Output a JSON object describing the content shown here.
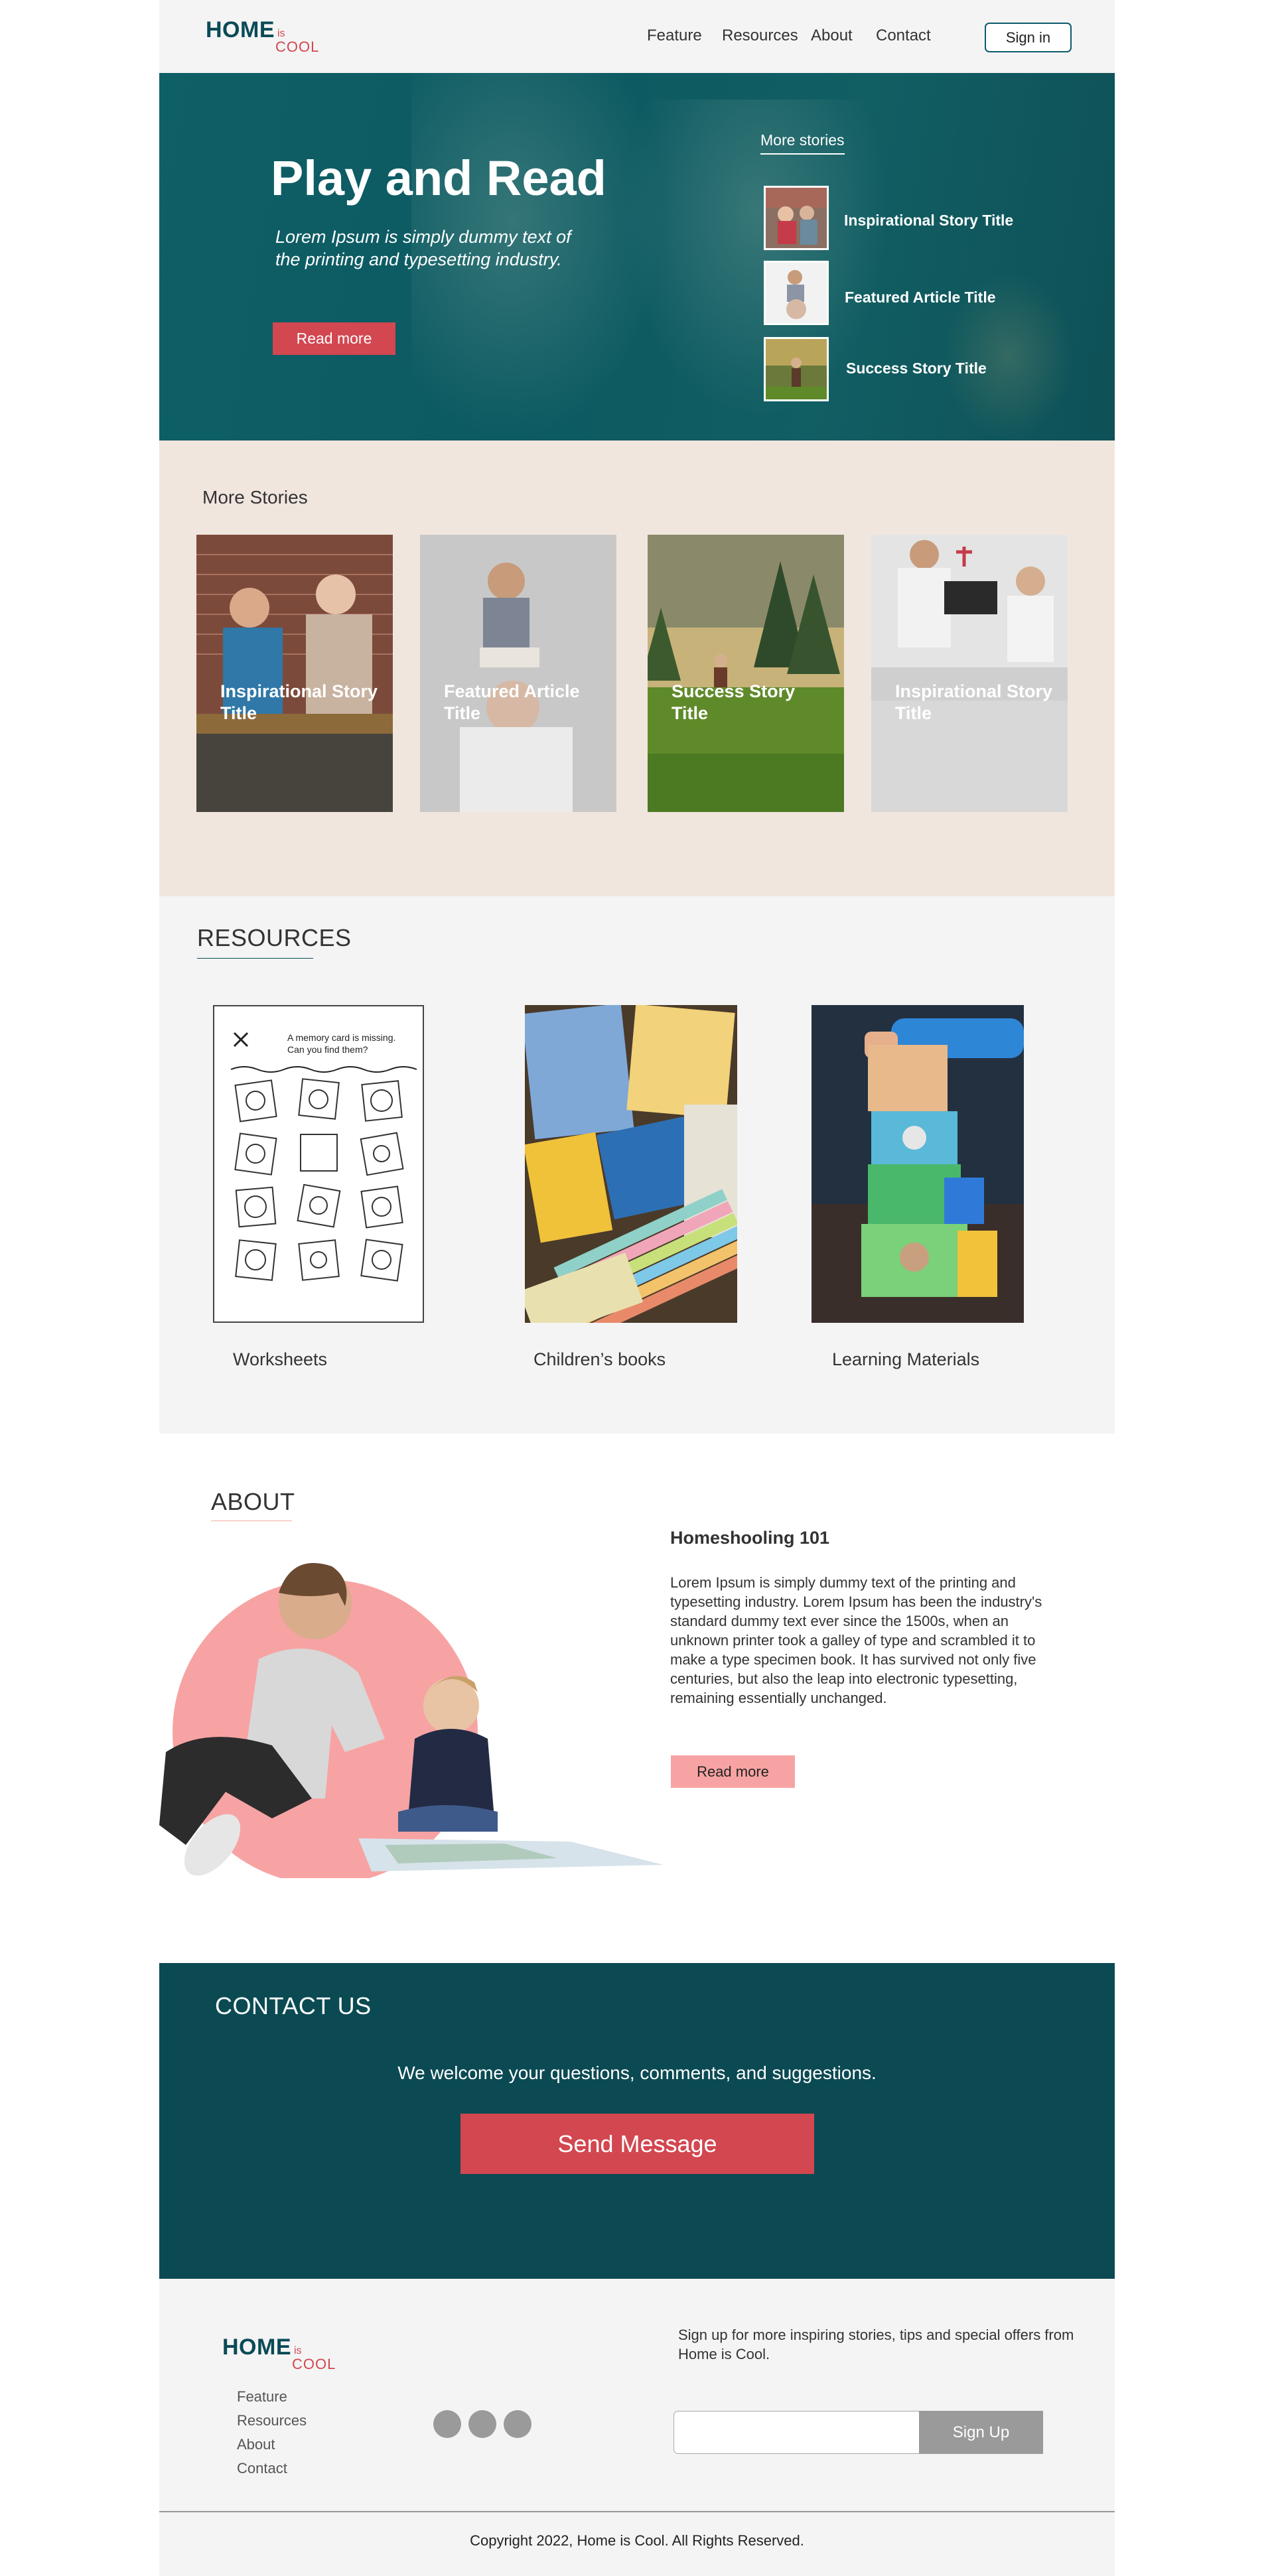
{
  "header": {
    "logo": {
      "home": "HOME",
      "is": "is",
      "cool": "COOL"
    },
    "nav": [
      "Feature",
      "Resources",
      "About",
      "Contact"
    ],
    "signin": "Sign in"
  },
  "hero": {
    "title": "Play and Read",
    "subtitle": "Lorem Ipsum is simply dummy text of the printing and typesetting industry.",
    "button": "Read more",
    "more_stories_label": "More stories",
    "stories": [
      "Inspirational Story Title",
      "Featured Article Title",
      "Success Story Title"
    ]
  },
  "more_stories": {
    "title": "More Stories",
    "cards": [
      "Inspirational Story Title",
      "Featured Article Title",
      "Success Story Title",
      "Inspirational Story Title"
    ]
  },
  "resources": {
    "title": "RESOURCES",
    "worksheet": {
      "heading_line1": "A memory card is missing.",
      "heading_line2": "Can you find them?"
    },
    "items": [
      "Worksheets",
      "Children’s books",
      "Learning Materials"
    ]
  },
  "about": {
    "title": "ABOUT",
    "heading": "Homeshooling 101",
    "body": "Lorem Ipsum is simply dummy text of the printing and typesetting industry. Lorem Ipsum has been the industry's standard dummy text ever since the 1500s, when an unknown printer took a galley of type and scrambled it to make a type specimen book. It has survived not only five centuries, but also the leap into electronic typesetting, remaining essentially unchanged.",
    "button": "Read more"
  },
  "contact": {
    "title": "CONTACT US",
    "message": "We welcome your questions, comments, and suggestions.",
    "button": "Send Message"
  },
  "footer": {
    "logo": {
      "home": "HOME",
      "is": "is",
      "cool": "COOL"
    },
    "links": [
      "Feature",
      "Resources",
      "About",
      "Contact"
    ],
    "signup_text": "Sign up for more inspiring stories, tips and special offers from Home is Cool.",
    "email_value": "",
    "signup_button": "Sign Up",
    "copyright": "Copyright 2022, Home is Cool. All Rights Reserved."
  },
  "colors": {
    "brand_teal": "#0b4a57",
    "accent_red": "#d24750",
    "accent_pink": "#f7a3a3",
    "beige": "#f1e6de"
  },
  "icons": [
    "social-icon-1",
    "social-icon-2",
    "social-icon-3"
  ]
}
